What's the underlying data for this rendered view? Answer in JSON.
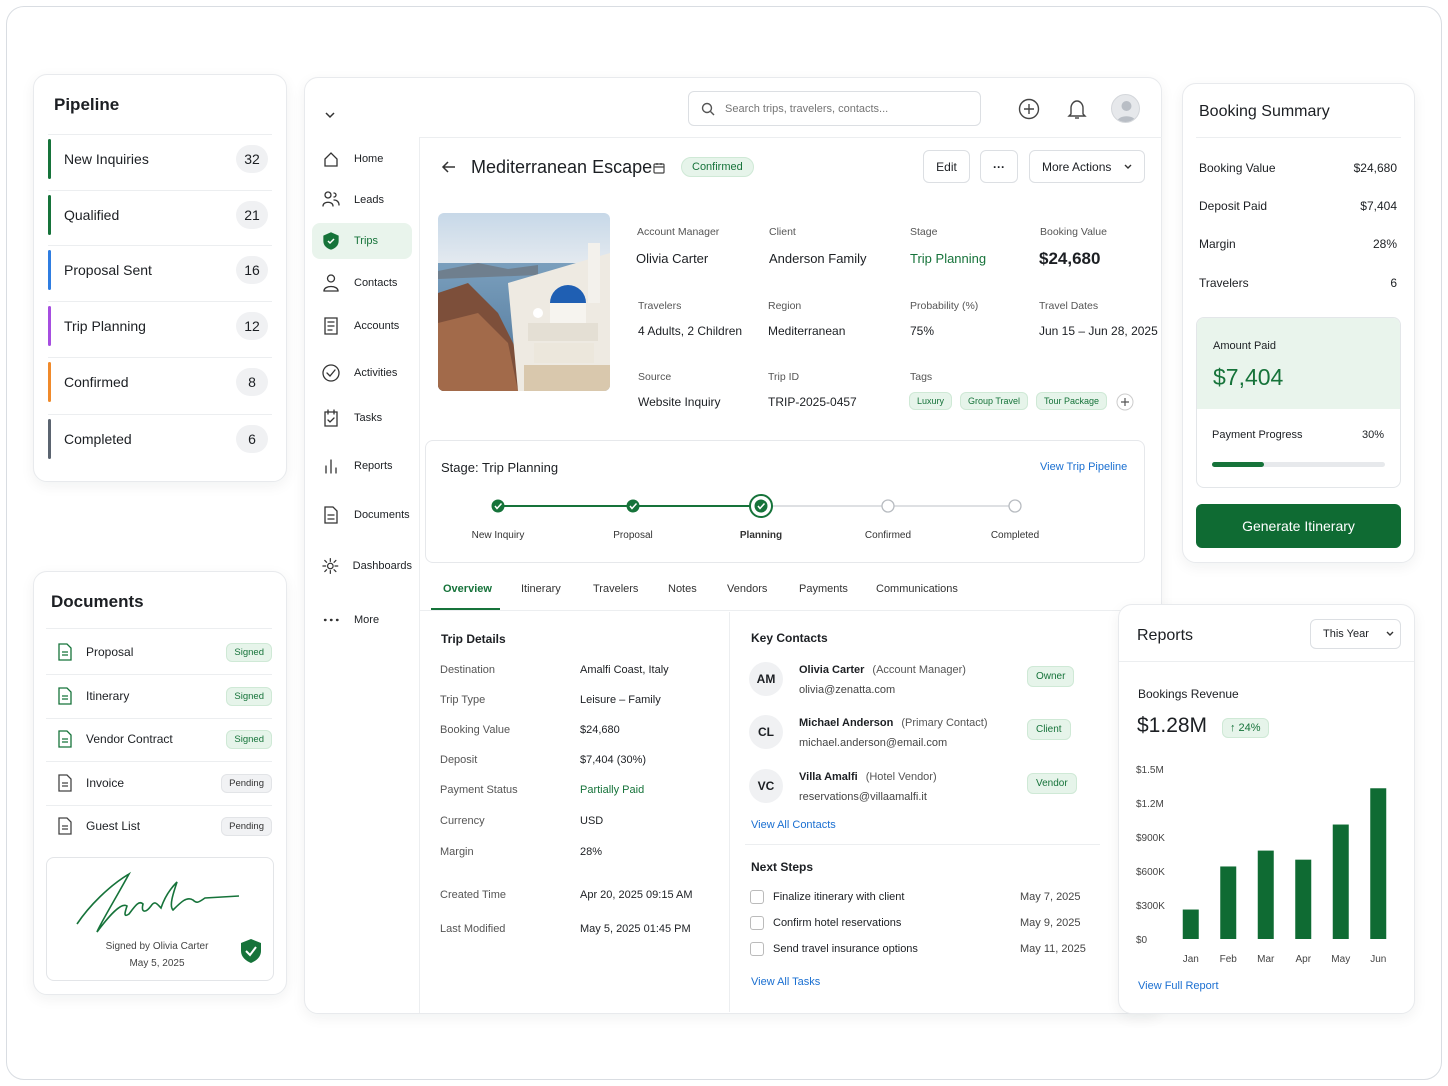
{
  "pipeline": {
    "title": "Pipeline",
    "items": [
      {
        "label": "New Inquiries",
        "count": "32",
        "color": "#16733a"
      },
      {
        "label": "Qualified",
        "count": "21",
        "color": "#16733a"
      },
      {
        "label": "Proposal Sent",
        "count": "16",
        "color": "#2f7de1"
      },
      {
        "label": "Trip Planning",
        "count": "12",
        "color": "#a64ee0"
      },
      {
        "label": "Confirmed",
        "count": "8",
        "color": "#f08a2b"
      },
      {
        "label": "Completed",
        "count": "6",
        "color": "#5b6470"
      }
    ]
  },
  "documents": {
    "title": "Documents",
    "items": [
      {
        "name": "Proposal",
        "status": "Signed"
      },
      {
        "name": "Itinerary",
        "status": "Signed"
      },
      {
        "name": "Vendor Contract",
        "status": "Signed"
      },
      {
        "name": "Invoice",
        "status": "Pending"
      },
      {
        "name": "Guest List",
        "status": "Pending"
      }
    ],
    "signature": {
      "signed_by": "Signed by Olivia Carter",
      "date": "May 5, 2025"
    }
  },
  "nav": {
    "items": [
      "Home",
      "Leads",
      "Trips",
      "Contacts",
      "Accounts",
      "Activities",
      "Tasks",
      "Reports",
      "Documents",
      "Dashboards",
      "More"
    ],
    "active": "Trips"
  },
  "search": {
    "placeholder": "Search trips, travelers, contacts..."
  },
  "trip": {
    "title": "Mediterranean Escape",
    "status": "Confirmed",
    "buttons": {
      "edit": "Edit",
      "more_dots": "···",
      "more_actions": "More Actions"
    },
    "fields": {
      "account_manager": {
        "label": "Account Manager",
        "value": "Olivia Carter"
      },
      "client": {
        "label": "Client",
        "value": "Anderson Family"
      },
      "stage": {
        "label": "Stage",
        "value": "Trip Planning"
      },
      "booking_value": {
        "label": "Booking Value",
        "value": "$24,680"
      },
      "travelers": {
        "label": "Travelers",
        "value": "4 Adults, 2 Children"
      },
      "region": {
        "label": "Region",
        "value": "Mediterranean"
      },
      "probability": {
        "label": "Probability (%)",
        "value": "75%"
      },
      "travel_dates": {
        "label": "Travel Dates",
        "value": "Jun 15 – Jun 28, 2025"
      },
      "source": {
        "label": "Source",
        "value": "Website Inquiry"
      },
      "trip_id": {
        "label": "Trip ID",
        "value": "TRIP-2025-0457"
      },
      "tags": {
        "label": "Tags",
        "values": [
          "Luxury",
          "Group Travel",
          "Tour Package"
        ]
      }
    }
  },
  "stage": {
    "title": "Stage: Trip Planning",
    "link": "View Trip Pipeline",
    "steps": [
      "New Inquiry",
      "Proposal",
      "Planning",
      "Confirmed",
      "Completed"
    ],
    "current_index": 2
  },
  "tabs": {
    "items": [
      "Overview",
      "Itinerary",
      "Travelers",
      "Notes",
      "Vendors",
      "Payments",
      "Communications"
    ],
    "active": "Overview"
  },
  "trip_details": {
    "title": "Trip Details",
    "rows": [
      {
        "label": "Destination",
        "value": "Amalfi Coast, Italy"
      },
      {
        "label": "Trip Type",
        "value": "Leisure – Family"
      },
      {
        "label": "Booking Value",
        "value": "$24,680"
      },
      {
        "label": "Deposit",
        "value": "$7,404 (30%)"
      },
      {
        "label": "Payment Status",
        "value": "Partially Paid"
      },
      {
        "label": "Currency",
        "value": "USD"
      },
      {
        "label": "Margin",
        "value": "28%"
      },
      {
        "label": "Created Time",
        "value": "Apr 20, 2025 09:15 AM"
      },
      {
        "label": "Last Modified",
        "value": "May 5, 2025 01:45 PM"
      }
    ]
  },
  "key_contacts": {
    "title": "Key Contacts",
    "link": "View All Contacts",
    "items": [
      {
        "initials": "AM",
        "name": "Olivia Carter",
        "role": "(Account Manager)",
        "email": "olivia@zenatta.com",
        "badge": "Owner"
      },
      {
        "initials": "CL",
        "name": "Michael Anderson",
        "role": "(Primary Contact)",
        "email": "michael.anderson@email.com",
        "badge": "Client"
      },
      {
        "initials": "VC",
        "name": "Villa Amalfi",
        "role": "(Hotel Vendor)",
        "email": "reservations@villaamalfi.it",
        "badge": "Vendor"
      }
    ]
  },
  "next_steps": {
    "title": "Next Steps",
    "link": "View All Tasks",
    "items": [
      {
        "task": "Finalize itinerary with client",
        "date": "May 7, 2025"
      },
      {
        "task": "Confirm hotel reservations",
        "date": "May 9, 2025"
      },
      {
        "task": "Send travel insurance options",
        "date": "May 11, 2025"
      }
    ]
  },
  "booking_summary": {
    "title": "Booking Summary",
    "rows": [
      {
        "label": "Booking Value",
        "value": "$24,680"
      },
      {
        "label": "Deposit Paid",
        "value": "$7,404"
      },
      {
        "label": "Margin",
        "value": "28%"
      },
      {
        "label": "Travelers",
        "value": "6"
      }
    ],
    "amount_paid_label": "Amount Paid",
    "amount_paid": "$7,404",
    "progress_label": "Payment Progress",
    "progress_text": "30%",
    "progress": 0.3,
    "cta": "Generate Itinerary"
  },
  "reports": {
    "title": "Reports",
    "period": "This Year",
    "subtitle": "Bookings Revenue",
    "total": "$1.28M",
    "change": "↑ 24%",
    "link": "View Full Report"
  },
  "chart_data": {
    "type": "bar",
    "categories": [
      "Jan",
      "Feb",
      "Mar",
      "Apr",
      "May",
      "Jun"
    ],
    "values": [
      260000,
      640000,
      780000,
      700000,
      1010000,
      1330000
    ],
    "yticks": [
      "$0",
      "$300K",
      "$600K",
      "$900K",
      "$1.2M",
      "$1.5M"
    ],
    "ylim": [
      0,
      1500000
    ],
    "color": "#0f6b33"
  }
}
